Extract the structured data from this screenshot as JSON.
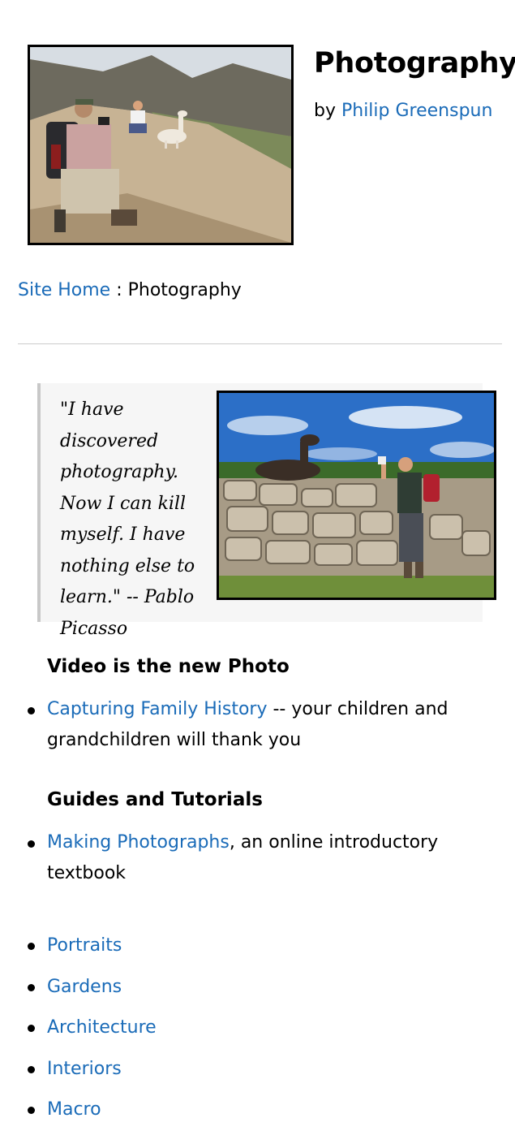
{
  "header": {
    "title": "Photography",
    "by_prefix": "by",
    "author_link": "Philip Greenspun"
  },
  "breadcrumb": {
    "home_link": "Site Home",
    "separator": " : ",
    "current": "Photography"
  },
  "quote": {
    "text": "\"I have discovered photography. Now I can kill myself. I have nothing else to learn.\" -- Pablo Picasso"
  },
  "sections": {
    "video": {
      "heading": "Video is the new Photo",
      "items": [
        {
          "link": "Capturing Family History",
          "rest": " -- your children and grandchildren will thank you"
        }
      ]
    },
    "guides": {
      "heading": "Guides and Tutorials",
      "items": [
        {
          "link": "Making Photographs",
          "rest": ", an online introductory textbook"
        }
      ]
    },
    "topics": [
      "Portraits",
      "Gardens",
      "Architecture",
      "Interiors",
      "Macro"
    ]
  },
  "colors": {
    "link": "#1a6bb8",
    "divider": "#cccccc",
    "quote_background": "#f6f6f6",
    "quote_border": "#c8c8c8"
  }
}
